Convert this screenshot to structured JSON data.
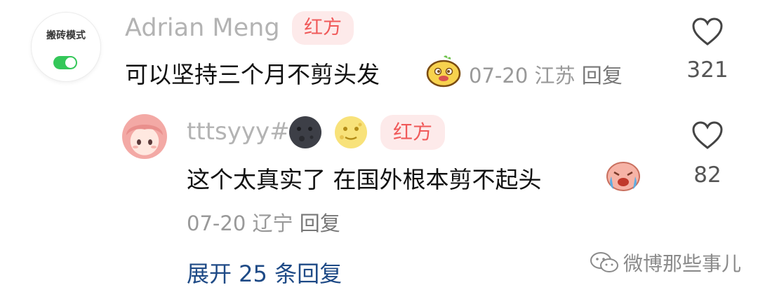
{
  "mode_switch": {
    "label": "搬砖模式",
    "state": "on"
  },
  "comments": [
    {
      "user": "Adrian Meng",
      "tag": "红方",
      "text": "可以坚持三个月不剪头发",
      "date": "07-20",
      "location": "江苏",
      "reply": "回复",
      "likes": "321"
    },
    {
      "user": "tttsyyy#",
      "tag": "红方",
      "text": "这个太真实了 在国外根本剪不起头",
      "date": "07-20",
      "location": "辽宁",
      "reply": "回复",
      "likes": "82"
    }
  ],
  "expand_replies": "展开 25 条回复",
  "watermark": "微博那些事儿",
  "icons": [
    "heart-outline-icon",
    "moon-dark-emoji",
    "moon-full-emoji",
    "pear-emoji",
    "crying-emoji",
    "wechat-icon"
  ],
  "colors": {
    "tag_bg": "#fdeaea",
    "tag_text": "#f05a5a",
    "link": "#1e4a86",
    "toggle": "#34c759"
  }
}
